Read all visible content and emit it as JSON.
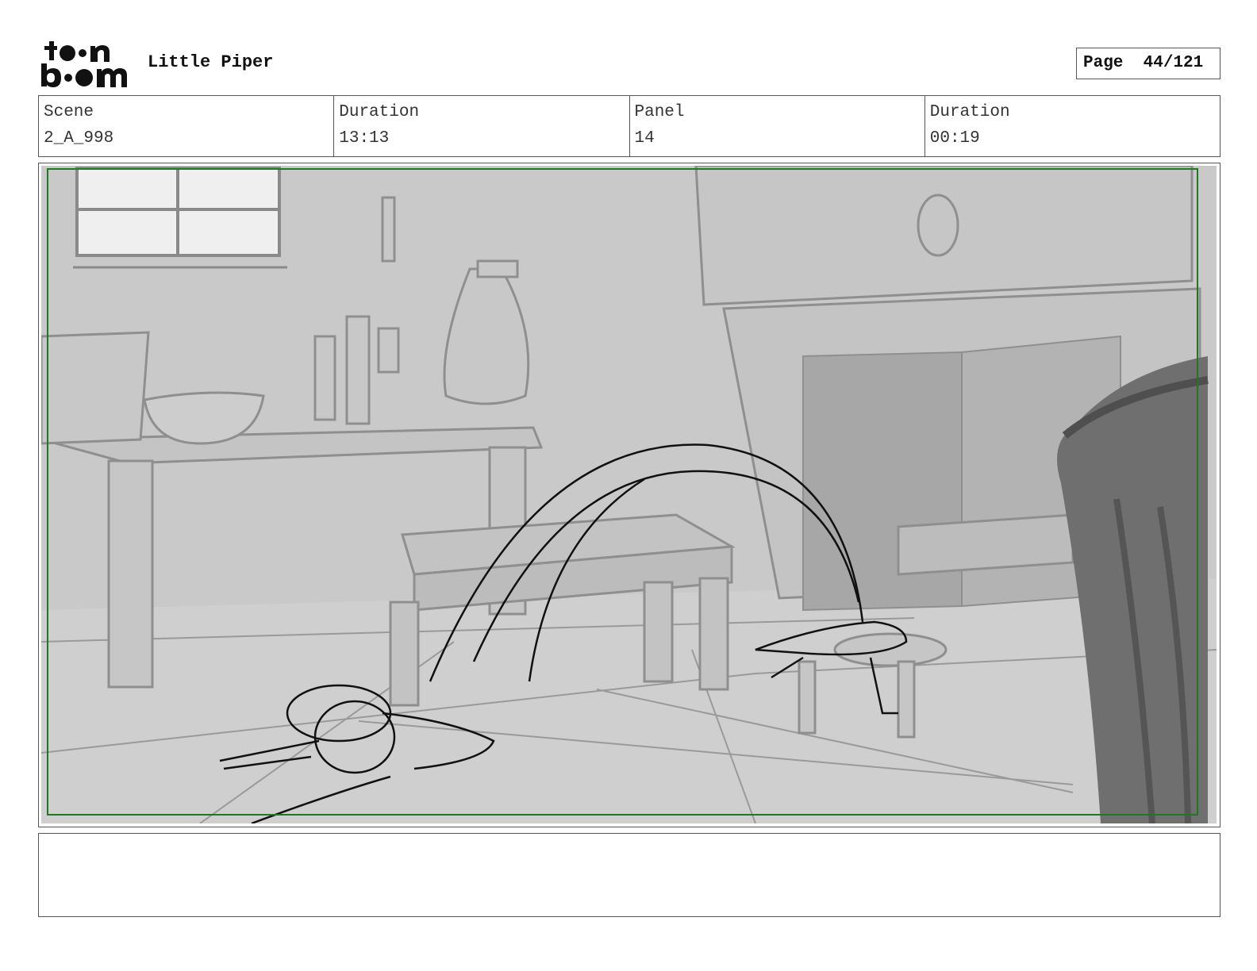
{
  "header": {
    "logo_text": "toon boom",
    "project_title": "Little Piper",
    "page_label": "Page",
    "page_number": "44/121"
  },
  "info": {
    "scene_label": "Scene",
    "scene_value": "2_A_998",
    "duration_label": "Duration",
    "duration_value": "13:13",
    "panel_label": "Panel",
    "panel_value": "14",
    "panel_duration_label": "Duration",
    "panel_duration_value": "00:19"
  },
  "panel_image": {
    "description_icon": "storyboard-sketch",
    "safe_frame_color": "#1f7a1f"
  },
  "notes": {
    "text": ""
  }
}
